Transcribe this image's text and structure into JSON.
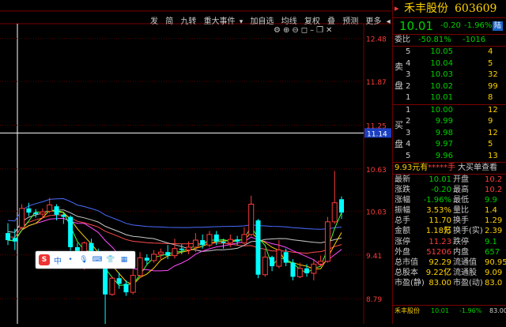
{
  "toolbar": {
    "items": [
      "发",
      "简",
      "九转",
      "重大事件",
      "▾",
      "加自选",
      "均线",
      "复权",
      "叠",
      "预测",
      "更多",
      "◂"
    ],
    "icons": [
      "gear-icon",
      "plus-circle-icon",
      "minus-circle-icon",
      "square-icon",
      "minimize-icon",
      "restore-icon",
      "close-icon"
    ]
  },
  "stock": {
    "name": "禾丰股份",
    "code": "603609",
    "price": "10.01",
    "change": "-0.20",
    "change_pct": "-1.96%",
    "tag": "陆"
  },
  "ratio": {
    "label": "委比",
    "pct": "-50.81%",
    "value": "-1016"
  },
  "sell_label": [
    "卖",
    "盘"
  ],
  "buy_label": [
    "买",
    "盘"
  ],
  "sell": [
    {
      "n": "5",
      "price": "10.05",
      "vol": "4"
    },
    {
      "n": "4",
      "price": "10.04",
      "vol": "5"
    },
    {
      "n": "3",
      "price": "10.03",
      "vol": "32"
    },
    {
      "n": "2",
      "price": "10.02",
      "vol": "99"
    },
    {
      "n": "1",
      "price": "10.01",
      "vol": "8"
    }
  ],
  "buy": [
    {
      "n": "1",
      "price": "10.00",
      "vol": "12"
    },
    {
      "n": "2",
      "price": "9.99",
      "vol": "9"
    },
    {
      "n": "3",
      "price": "9.98",
      "vol": "12"
    },
    {
      "n": "4",
      "price": "9.97",
      "vol": "5"
    },
    {
      "n": "5",
      "price": "9.96",
      "vol": "13"
    }
  ],
  "notice": {
    "a": "9.93元有",
    "b": "*****手",
    "c": "大买单查看"
  },
  "stats": [
    [
      "最新",
      "10.01",
      "开盘",
      "10.2"
    ],
    [
      "涨跌",
      "-0.20",
      "最高",
      "10.2"
    ],
    [
      "涨幅",
      "-1.96%",
      "最低",
      "9.9"
    ],
    [
      "振幅",
      "3.53%",
      "量比",
      "1.4"
    ],
    [
      "总手",
      "11.70万",
      "换手",
      "1.29"
    ],
    [
      "金额",
      "1.18亿",
      "换手(实)",
      "2.39"
    ],
    [
      "涨停",
      "11.23",
      "跌停",
      "9.1"
    ],
    [
      "外盘",
      "51206",
      "内盘",
      "657"
    ],
    [
      "总市值",
      "92.29亿",
      "流通值",
      "90.95"
    ],
    [
      "总股本",
      "9.22亿",
      "流通股",
      "9.09"
    ],
    [
      "市盈(静)",
      "83.00",
      "市盈(动)",
      "83.0"
    ]
  ],
  "footer": {
    "name": "禾丰股份",
    "price": "10.01",
    "pct": "-1.96%",
    "tail": "83.00"
  },
  "float_toolbar": {
    "label": "中"
  },
  "chart_data": {
    "type": "candlestick",
    "yticks": [
      "12.48",
      "11.87",
      "11.25",
      "10.63",
      "10.03",
      "9.41",
      "8.79"
    ],
    "ylim": [
      8.5,
      12.6
    ],
    "crosshair_value": "11.14",
    "low_annotation": "8.39",
    "candles": [
      [
        9.72,
        9.62,
        9.86,
        9.55
      ],
      [
        9.65,
        9.6,
        9.78,
        9.48
      ],
      [
        9.8,
        10.07,
        10.13,
        9.75
      ],
      [
        10.07,
        10.01,
        10.15,
        9.96
      ],
      [
        10.01,
        9.99,
        10.06,
        9.94
      ],
      [
        9.99,
        10.02,
        10.07,
        9.93
      ],
      [
        10.03,
        10.12,
        10.22,
        10.0
      ],
      [
        10.1,
        9.98,
        10.13,
        9.9
      ],
      [
        9.98,
        9.95,
        10.02,
        9.85
      ],
      [
        9.95,
        9.52,
        9.97,
        9.47
      ],
      [
        9.52,
        9.33,
        9.58,
        9.25
      ],
      [
        9.33,
        9.58,
        9.6,
        9.2
      ],
      [
        9.58,
        9.45,
        9.64,
        9.38
      ],
      [
        9.45,
        9.35,
        9.5,
        9.27
      ],
      [
        9.35,
        8.85,
        9.4,
        8.39
      ],
      [
        8.85,
        9.08,
        9.1,
        8.83
      ],
      [
        9.08,
        9.0,
        9.16,
        8.93
      ],
      [
        9.0,
        8.88,
        9.05,
        8.83
      ],
      [
        8.88,
        9.12,
        9.2,
        8.85
      ],
      [
        9.12,
        9.37,
        9.45,
        9.08
      ],
      [
        9.37,
        9.33,
        9.42,
        9.28
      ],
      [
        9.33,
        9.42,
        9.48,
        9.3
      ],
      [
        9.42,
        9.45,
        9.5,
        9.35
      ],
      [
        9.45,
        9.4,
        9.55,
        9.35
      ],
      [
        9.4,
        9.5,
        9.64,
        9.36
      ],
      [
        9.5,
        9.48,
        9.56,
        9.42
      ],
      [
        9.48,
        9.52,
        9.6,
        9.42
      ],
      [
        9.52,
        9.62,
        9.72,
        9.45
      ],
      [
        9.62,
        9.55,
        9.7,
        9.5
      ],
      [
        9.55,
        9.7,
        9.75,
        9.52
      ],
      [
        9.7,
        9.6,
        9.75,
        9.55
      ],
      [
        9.6,
        9.58,
        9.64,
        9.5
      ],
      [
        9.58,
        9.63,
        9.7,
        9.52
      ],
      [
        9.63,
        9.6,
        9.68,
        9.55
      ],
      [
        9.58,
        9.7,
        9.8,
        9.56
      ],
      [
        9.7,
        10.13,
        10.25,
        9.68
      ],
      [
        9.9,
        9.13,
        9.92,
        9.08
      ],
      [
        9.13,
        9.38,
        9.48,
        9.1
      ],
      [
        9.38,
        9.25,
        9.4,
        9.18
      ],
      [
        9.25,
        9.48,
        9.62,
        9.22
      ],
      [
        9.45,
        9.3,
        9.5,
        9.25
      ],
      [
        9.3,
        9.1,
        9.35,
        9.05
      ],
      [
        9.1,
        9.22,
        9.3,
        9.08
      ],
      [
        9.22,
        9.15,
        9.28,
        9.1
      ],
      [
        9.15,
        9.28,
        9.35,
        9.05
      ],
      [
        9.28,
        9.32,
        9.4,
        9.25
      ],
      [
        9.32,
        9.88,
        9.95,
        9.3
      ],
      [
        9.88,
        10.15,
        10.6,
        9.85
      ],
      [
        10.2,
        10.01,
        10.24,
        9.92
      ]
    ]
  }
}
